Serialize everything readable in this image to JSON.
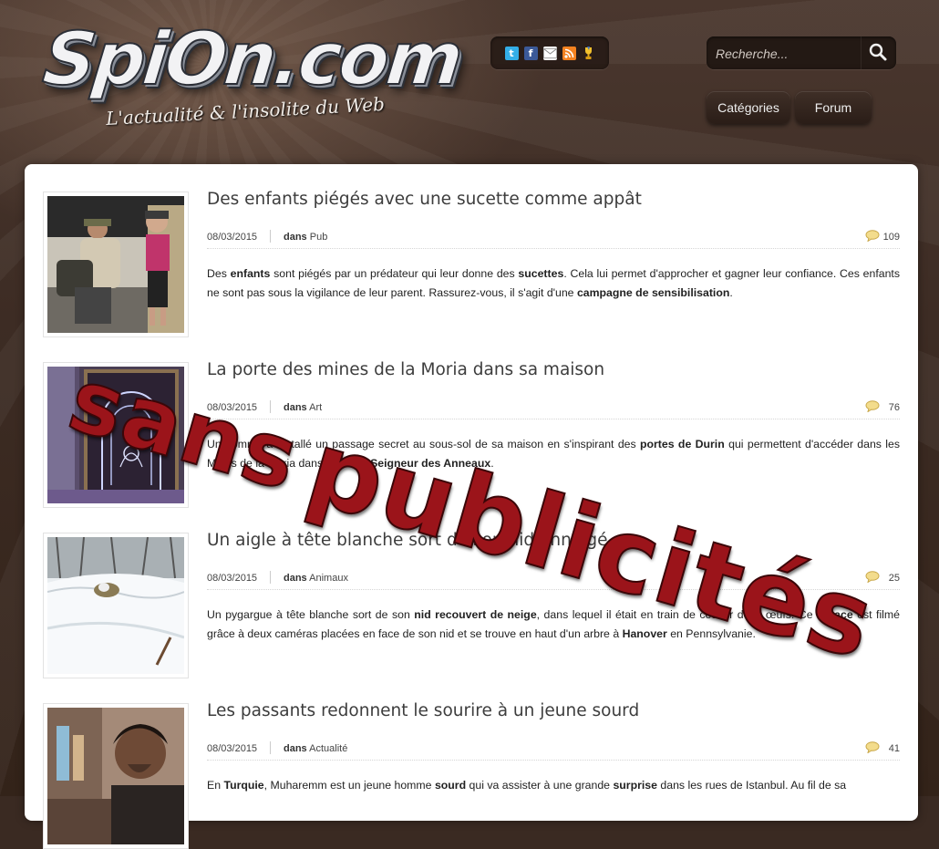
{
  "site": {
    "logo_text": "SpiOn.com",
    "tagline": "L'actualité & l'insolite du Web"
  },
  "social_icons": [
    "twitter-icon",
    "facebook-icon",
    "email-icon",
    "rss-icon",
    "trophy-icon"
  ],
  "search": {
    "placeholder": "Recherche..."
  },
  "nav": {
    "categories": "Catégories",
    "forum": "Forum"
  },
  "colors": {
    "accent_red": "#9b141a",
    "background_brown": "#3d2c24",
    "comment_bubble": "#e7cf80"
  },
  "overlay": {
    "line1": "sans",
    "line2": "publicités"
  },
  "posts": [
    {
      "title": "Des enfants piégés avec une sucette comme appât",
      "date": "08/03/2015",
      "in": "dans",
      "category": "Pub",
      "comments": "109",
      "excerpt": [
        {
          "t": "Des ",
          "b": false
        },
        {
          "t": "enfants",
          "b": true
        },
        {
          "t": " sont piégés par un prédateur qui leur donne des ",
          "b": false
        },
        {
          "t": "sucettes",
          "b": true
        },
        {
          "t": ". Cela lui permet d'approcher et gagner leur confiance. Ces enfants ne sont pas sous la vigilance de leur parent. Rassurez-vous, il s'agit d'une ",
          "b": false
        },
        {
          "t": "campagne de sensibilisation",
          "b": true
        },
        {
          "t": ".",
          "b": false
        }
      ]
    },
    {
      "title": "La porte des mines de la Moria dans sa maison",
      "date": "08/03/2015",
      "in": "dans",
      "category": "Art",
      "comments": "76",
      "excerpt": [
        {
          "t": "Un homme a installé un passage secret au sous-sol de sa maison en s'inspirant des ",
          "b": false
        },
        {
          "t": "portes de Durin",
          "b": true
        },
        {
          "t": " qui permettent d'accéder dans les Mines de la Moria dans le film le ",
          "b": false
        },
        {
          "t": "Seigneur des Anneaux",
          "b": true
        },
        {
          "t": ".",
          "b": false
        }
      ]
    },
    {
      "title": "Un aigle à tête blanche sort de son nid enneigé",
      "date": "08/03/2015",
      "in": "dans",
      "category": "Animaux",
      "comments": "25",
      "excerpt": [
        {
          "t": "Un pygargue à tête blanche sort de son ",
          "b": false
        },
        {
          "t": "nid recouvert de neige",
          "b": true
        },
        {
          "t": ", dans lequel il était en train de couver deux œufs. Ce ",
          "b": false
        },
        {
          "t": "rapace",
          "b": true
        },
        {
          "t": " est filmé grâce à deux caméras placées en face de son nid et se trouve en haut d'un arbre à ",
          "b": false
        },
        {
          "t": "Hanover",
          "b": true
        },
        {
          "t": " en Pennsylvanie.",
          "b": false
        }
      ]
    },
    {
      "title": "Les passants redonnent le sourire à un jeune sourd",
      "date": "08/03/2015",
      "in": "dans",
      "category": "Actualité",
      "comments": "41",
      "excerpt": [
        {
          "t": "En ",
          "b": false
        },
        {
          "t": "Turquie",
          "b": true
        },
        {
          "t": ", Muharemm est un jeune homme ",
          "b": false
        },
        {
          "t": "sourd",
          "b": true
        },
        {
          "t": " qui va assister à une grande ",
          "b": false
        },
        {
          "t": "surprise",
          "b": true
        },
        {
          "t": " dans les rues de Istanbul. Au fil de sa",
          "b": false
        }
      ]
    }
  ]
}
